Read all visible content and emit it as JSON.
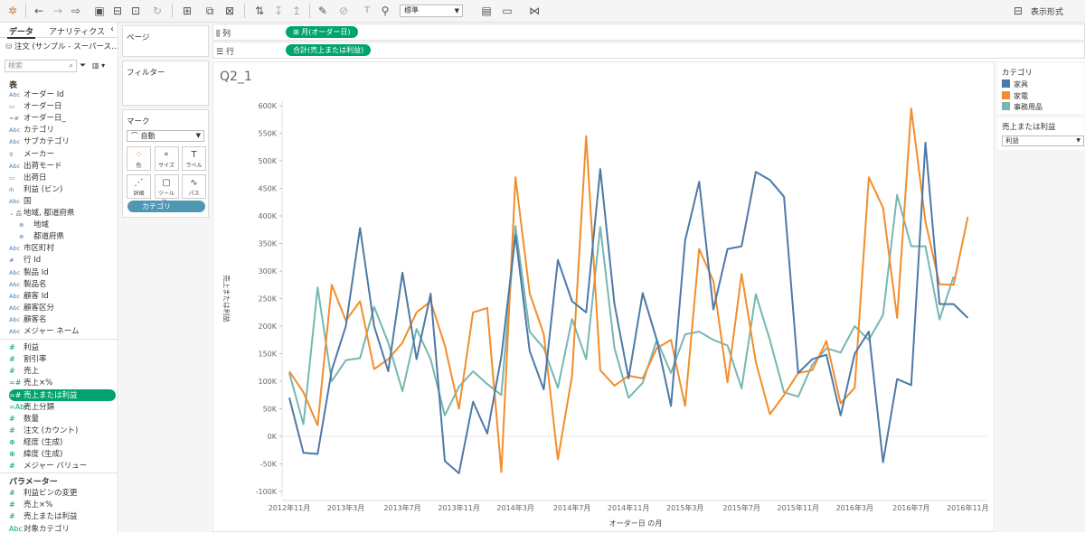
{
  "toolbar": {
    "format_value": "標準",
    "show_me_label": "表示形式",
    "icons": [
      "tableau-logo-icon",
      "undo-icon",
      "redo-icon",
      "redo-menu-icon",
      "save-icon",
      "new-datasource-icon",
      "pause-icon",
      "refresh-icon",
      "new-worksheet-icon",
      "duplicate-icon",
      "clear-icon",
      "swap-icon",
      "sort-asc-icon",
      "sort-desc-icon",
      "highlight-icon",
      "group-icon",
      "show-labels-icon",
      "pin-icon",
      "fit-icon",
      "presentation-icon",
      "share-icon",
      "show-me-icon"
    ]
  },
  "datapane": {
    "tab_data": "データ",
    "tab_analytics": "アナリティクス",
    "collapse": "‹",
    "datasource": "注文 (サンプル - スーパース…",
    "search_placeholder": "検索",
    "section_tables": "表",
    "fields": [
      {
        "icon": "Abc",
        "label": "オーダー Id"
      },
      {
        "icon": "▭",
        "label": "オーダー日"
      },
      {
        "icon": "=#",
        "label": "オーダー日_"
      },
      {
        "icon": "Abc",
        "label": "カテゴリ"
      },
      {
        "icon": "Abc",
        "label": "サブカテゴリ"
      },
      {
        "icon": "⚲",
        "label": "メーカー"
      },
      {
        "icon": "Abc",
        "label": "出荷モード"
      },
      {
        "icon": "▭",
        "label": "出荷日"
      },
      {
        "icon": "ılı",
        "label": "利益 (ビン)"
      },
      {
        "icon": "Abc",
        "label": "国"
      },
      {
        "icon": "品",
        "label": "地域, 都道府県",
        "group": true
      },
      {
        "icon": "⊕",
        "label": "地域",
        "sub": true
      },
      {
        "icon": "⊕",
        "label": "都道府県",
        "sub": true
      },
      {
        "icon": "Abc",
        "label": "市区町村"
      },
      {
        "icon": "#",
        "label": "行 Id"
      },
      {
        "icon": "Abc",
        "label": "製品 Id"
      },
      {
        "icon": "Abc",
        "label": "製品名"
      },
      {
        "icon": "Abc",
        "label": "顧客 Id"
      },
      {
        "icon": "Abc",
        "label": "顧客区分"
      },
      {
        "icon": "Abc",
        "label": "顧客名"
      },
      {
        "icon": "Abc",
        "label": "メジャー ネーム"
      }
    ],
    "measures": [
      {
        "icon": "#",
        "label": "利益"
      },
      {
        "icon": "#",
        "label": "割引率"
      },
      {
        "icon": "#",
        "label": "売上"
      },
      {
        "icon": "=#",
        "label": "売上×%"
      },
      {
        "icon": "=#",
        "label": "売上または利益",
        "highlight": true
      },
      {
        "icon": "=Abc",
        "label": "売上分類"
      },
      {
        "icon": "#",
        "label": "数量"
      },
      {
        "icon": "#",
        "label": "注文 (カウント)"
      },
      {
        "icon": "⊕",
        "label": "経度 (生成)"
      },
      {
        "icon": "⊕",
        "label": "緯度 (生成)"
      },
      {
        "icon": "#",
        "label": "メジャー バリュー"
      }
    ],
    "section_params": "パラメーター",
    "params": [
      {
        "icon": "#",
        "label": "利益ビンの変更"
      },
      {
        "icon": "#",
        "label": "売上×%"
      },
      {
        "icon": "#",
        "label": "売上または利益"
      },
      {
        "icon": "Abc",
        "label": "対象カテゴリ"
      }
    ]
  },
  "pages_label": "ページ",
  "filters_label": "フィルター",
  "marks": {
    "title": "マーク",
    "type": "自動",
    "buttons": [
      {
        "icon": "⁘",
        "label": "色"
      },
      {
        "icon": "⚬",
        "label": "サイズ"
      },
      {
        "icon": "T",
        "label": "ラベル"
      },
      {
        "icon": "⋰",
        "label": "詳細"
      },
      {
        "icon": "▢",
        "label": "ツールヒ.."
      },
      {
        "icon": "∿",
        "label": "パス"
      }
    ],
    "pill": "カテゴリ"
  },
  "shelves": {
    "columns_label": "列",
    "columns_pill": "⊞ 月(オーダー日)",
    "rows_label": "行",
    "rows_pill": "合計(売上または利益)"
  },
  "viz": {
    "title": "Q2_1"
  },
  "legend": {
    "title": "カテゴリ",
    "items": [
      {
        "label": "家具",
        "color": "#4e79a7"
      },
      {
        "label": "家電",
        "color": "#f28e2b"
      },
      {
        "label": "事務用品",
        "color": "#76b7b2"
      }
    ],
    "param_title": "売上または利益",
    "param_value": "利益"
  },
  "chart_data": {
    "type": "line",
    "xlabel": "オーダー日 の月",
    "ylabel": "売上または利益",
    "x_start": "2012年11月",
    "x": [
      "2012-11",
      "2012-12",
      "2013-01",
      "2013-02",
      "2013-03",
      "2013-04",
      "2013-05",
      "2013-06",
      "2013-07",
      "2013-08",
      "2013-09",
      "2013-10",
      "2013-11",
      "2013-12",
      "2014-01",
      "2014-02",
      "2014-03",
      "2014-04",
      "2014-05",
      "2014-06",
      "2014-07",
      "2014-08",
      "2014-09",
      "2014-10",
      "2014-11",
      "2014-12",
      "2015-01",
      "2015-02",
      "2015-03",
      "2015-04",
      "2015-05",
      "2015-06",
      "2015-07",
      "2015-08",
      "2015-09",
      "2015-10",
      "2015-11",
      "2015-12",
      "2016-01",
      "2016-02",
      "2016-03",
      "2016-04",
      "2016-05",
      "2016-06",
      "2016-07",
      "2016-08",
      "2016-09",
      "2016-10",
      "2016-11",
      "2016-12"
    ],
    "x_ticks": [
      "2012年11月",
      "2013年3月",
      "2013年7月",
      "2013年11月",
      "2014年3月",
      "2014年7月",
      "2014年11月",
      "2015年3月",
      "2015年7月",
      "2015年11月",
      "2016年3月",
      "2016年7月",
      "2016年11月"
    ],
    "x_tick_index": [
      0,
      4,
      8,
      12,
      16,
      20,
      24,
      28,
      32,
      36,
      40,
      44,
      48
    ],
    "ylim": [
      -100000,
      600000
    ],
    "y_ticks": [
      -100000,
      -50000,
      0,
      50000,
      100000,
      150000,
      200000,
      250000,
      300000,
      350000,
      400000,
      450000,
      500000,
      550000,
      600000
    ],
    "y_tick_labels": [
      "-100K",
      "-50K",
      "0K",
      "50K",
      "100K",
      "150K",
      "200K",
      "250K",
      "300K",
      "350K",
      "400K",
      "450K",
      "500K",
      "550K",
      "600K"
    ],
    "grid": false,
    "series": [
      {
        "name": "家具",
        "color": "#4e79a7",
        "values": [
          70000,
          -30000,
          -32000,
          120000,
          200000,
          378000,
          200000,
          118000,
          297000,
          140000,
          259000,
          -45000,
          -67000,
          63000,
          5000,
          145000,
          365000,
          155000,
          85000,
          320000,
          245000,
          225000,
          485000,
          240000,
          105000,
          260000,
          175000,
          55000,
          355000,
          462000,
          230000,
          340000,
          345000,
          480000,
          465000,
          435000,
          115000,
          140000,
          148000,
          38000,
          150000,
          190000,
          -47000,
          104000,
          93000,
          533000,
          240000,
          240000,
          215000,
          null
        ]
      },
      {
        "name": "家電",
        "color": "#f28e2b",
        "values": [
          118000,
          80000,
          20000,
          275000,
          210000,
          245000,
          122000,
          140000,
          170000,
          225000,
          245000,
          165000,
          50000,
          225000,
          233000,
          -65000,
          470000,
          260000,
          185000,
          -42000,
          110000,
          545000,
          120000,
          92000,
          110000,
          105000,
          160000,
          175000,
          55000,
          340000,
          282000,
          98000,
          295000,
          135000,
          40000,
          75000,
          115000,
          120000,
          173000,
          60000,
          88000,
          470000,
          415000,
          215000,
          595000,
          390000,
          276000,
          275000,
          398000,
          null
        ]
      },
      {
        "name": "事務用品",
        "color": "#76b7b2",
        "values": [
          115000,
          22000,
          270000,
          100000,
          138000,
          142000,
          235000,
          170000,
          82000,
          195000,
          140000,
          38000,
          90000,
          118000,
          95000,
          75000,
          382000,
          190000,
          160000,
          88000,
          213000,
          140000,
          380000,
          160000,
          70000,
          97000,
          175000,
          115000,
          185000,
          190000,
          175000,
          165000,
          87000,
          258000,
          175000,
          80000,
          72000,
          130000,
          160000,
          152000,
          200000,
          175000,
          220000,
          438000,
          345000,
          345000,
          212000,
          290000,
          null,
          null
        ]
      }
    ]
  }
}
